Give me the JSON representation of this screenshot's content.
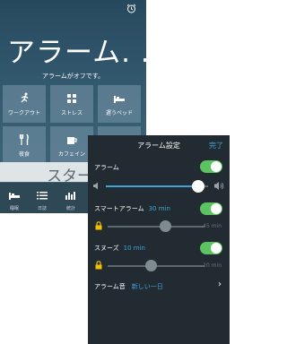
{
  "home": {
    "title": "アラーム. . .",
    "status": "アラームがオフです。",
    "tiles": [
      {
        "label": "ワークアウト",
        "icon": "runner-icon"
      },
      {
        "label": "ストレス",
        "icon": "stress-icon"
      },
      {
        "label": "遅うベッド",
        "icon": "bed-icon"
      },
      {
        "label": "夜食",
        "icon": "food-icon"
      },
      {
        "label": "カフェイン",
        "icon": "coffee-icon"
      },
      {
        "label": "",
        "icon": "glass-icon"
      }
    ],
    "start_label": "スター",
    "tabs": [
      {
        "label": "睡眠",
        "icon": "bed-tab-icon"
      },
      {
        "label": "日誌",
        "icon": "list-icon"
      },
      {
        "label": "統計",
        "icon": "bar-chart-icon"
      }
    ]
  },
  "settings": {
    "title": "アラーム設定",
    "done_label": "完了",
    "alarm": {
      "label": "アラーム",
      "on": true
    },
    "volume_level": 0.9,
    "smart": {
      "label": "スマートアラーム",
      "value": "30 min",
      "on": true,
      "slider_max": "45 min",
      "level": 0.6
    },
    "snooze": {
      "label": "スヌーズ",
      "value": "10 min",
      "on": true,
      "slider_max": "20 min",
      "level": 0.45
    },
    "sound": {
      "label": "アラーム音",
      "value": "新しい一日"
    }
  },
  "colors": {
    "accent": "#3ea5d9",
    "toggle_on": "#5bc35f",
    "lock": "#f2c200"
  }
}
